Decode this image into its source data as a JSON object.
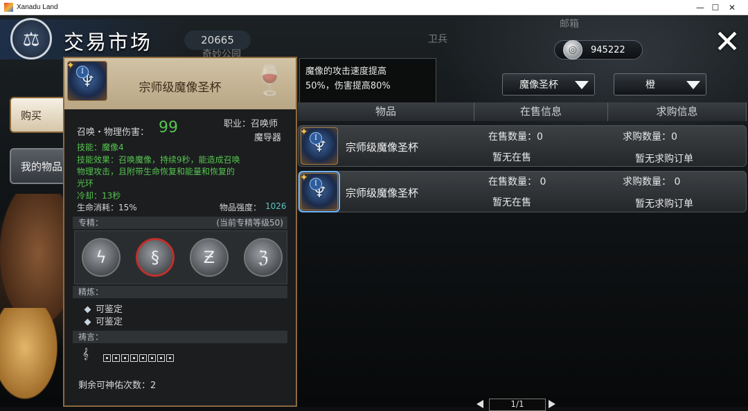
{
  "window": {
    "title": "Xanadu Land",
    "minimize": "—",
    "maximize": "☐",
    "close": "✕"
  },
  "background": {
    "nameplate": "20665",
    "label_guard": "卫兵",
    "label_mailbox": "邮箱",
    "label_under": "奇妙公园"
  },
  "header": {
    "title": "交易市场",
    "currency_value": "945222",
    "close_symbol": "✕"
  },
  "nav": {
    "buy": "购买",
    "my_items": "我的物品"
  },
  "filters": {
    "item_type": "魔像圣杯",
    "quality": "橙"
  },
  "description": {
    "line1": "魔像的攻击速度提高",
    "line2": "50%，伤害提高80%"
  },
  "columns": {
    "item": "物品",
    "on_sale": "在售信息",
    "buy_orders": "求购信息"
  },
  "rows": [
    {
      "name": "宗师级魔像圣杯",
      "sale_count": "在售数量：0",
      "sale_status": "暂无在售",
      "buy_count": "求购数量：0",
      "buy_status": "暂无求购订单",
      "selected": false
    },
    {
      "name": "宗师级魔像圣杯",
      "sale_count": "在售数量： 0",
      "sale_status": "暂无在售",
      "buy_count": "求购数量： 0",
      "buy_status": "暂无求购订单",
      "selected": true
    }
  ],
  "pager": {
    "text": "1/1"
  },
  "tooltip": {
    "title": "宗师级魔像圣杯",
    "tier": "I",
    "damage_label": "召唤・物理伤害：",
    "damage_value": "99",
    "class_line1": "职业：召唤师",
    "class_line2": "魔导器",
    "skill": "技能：魔像4",
    "effect_line1": "技能效果：召唤魔像，持续9秒，能造成召唤",
    "effect_line2": "物理攻击，且附带生命恢复和能量和恢复的",
    "effect_line3": "光环",
    "cooldown": "冷却：13秒",
    "hp_cost": "生命消耗：15%",
    "strength_label": "物品强度：",
    "strength_value": "1026",
    "mastery_label": "专精：",
    "mastery_level": "(当前专精等级50)",
    "refine_label": "精炼：",
    "refine_items": [
      "可鉴定",
      "可鉴定"
    ],
    "prayer_label": "祷言：",
    "remaining": "剩余可神佑次数：2",
    "mastery_selected_index": 1
  },
  "colors": {
    "accent_green": "#56c44f",
    "frame_gold": "#8c6a3e",
    "selection_red": "#c0302c"
  }
}
